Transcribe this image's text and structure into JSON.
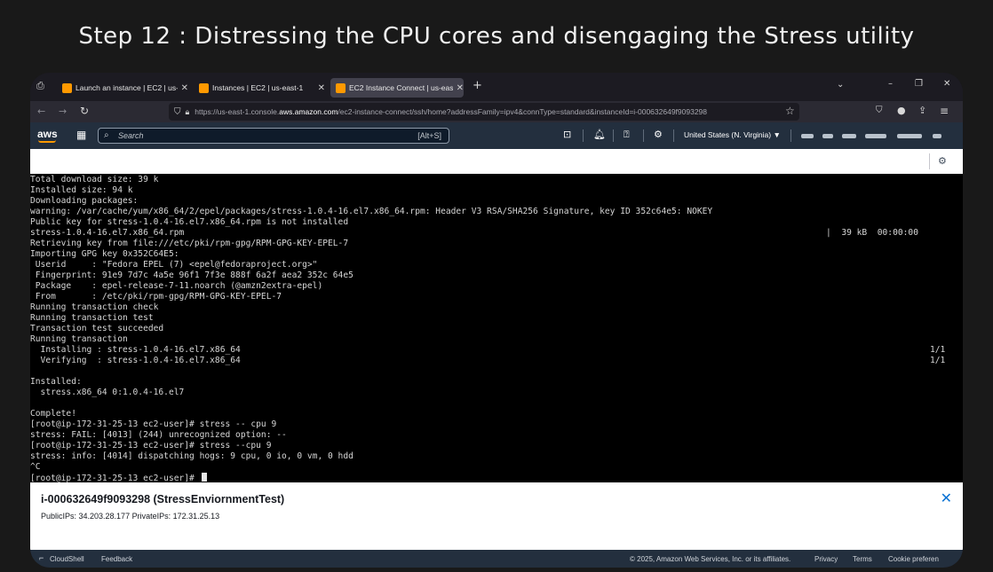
{
  "heading": "Step 12 : Distressing the CPU cores and disengaging the Stress utility",
  "browser": {
    "tabs": [
      {
        "label": "Launch an instance | EC2 | us-east-1",
        "active": false
      },
      {
        "label": "Instances | EC2 | us-east-1",
        "active": false
      },
      {
        "label": "EC2 Instance Connect | us-east-1",
        "active": true
      }
    ],
    "url_prefix": "https://us-east-1.console.",
    "url_host": "aws.amazon.com",
    "url_path": "/ec2-instance-connect/ssh/home?addressFamily=ipv4&connType=standard&instanceId=i-000632649f9093298"
  },
  "aws_header": {
    "logo": "aws",
    "search_placeholder": "Search",
    "search_shortcut": "[Alt+S]",
    "region": "United States (N. Virginia) ▼"
  },
  "terminal": {
    "lines": [
      "Total download size: 39 k",
      "Installed size: 94 k",
      "Downloading packages:",
      "warning: /var/cache/yum/x86_64/2/epel/packages/stress-1.0.4-16.el7.x86_64.rpm: Header V3 RSA/SHA256 Signature, key ID 352c64e5: NOKEY",
      "Public key for stress-1.0.4-16.el7.x86_64.rpm is not installed",
      "stress-1.0.4-16.el7.x86_64.rpm",
      "Retrieving key from file:///etc/pki/rpm-gpg/RPM-GPG-KEY-EPEL-7",
      "Importing GPG key 0x352C64E5:",
      " Userid     : \"Fedora EPEL (7) <epel@fedoraproject.org>\"",
      " Fingerprint: 91e9 7d7c 4a5e 96f1 7f3e 888f 6a2f aea2 352c 64e5",
      " Package    : epel-release-7-11.noarch (@amzn2extra-epel)",
      " From       : /etc/pki/rpm-gpg/RPM-GPG-KEY-EPEL-7",
      "Running transaction check",
      "Running transaction test",
      "Transaction test succeeded",
      "Running transaction",
      "  Installing : stress-1.0.4-16.el7.x86_64",
      "  Verifying  : stress-1.0.4-16.el7.x86_64",
      "",
      "Installed:",
      "  stress.x86_64 0:1.0.4-16.el7",
      "",
      "Complete!",
      "[root@ip-172-31-25-13 ec2-user]# stress -- cpu 9",
      "stress: FAIL: [4013] (244) unrecognized option: --",
      "[root@ip-172-31-25-13 ec2-user]# stress --cpu 9",
      "stress: info: [4014] dispatching hogs: 9 cpu, 0 io, 0 vm, 0 hdd",
      "^C",
      "[root@ip-172-31-25-13 ec2-user]# "
    ],
    "download_stat": "|  39 kB  00:00:00",
    "progress_1": "1/1",
    "progress_2": "1/1"
  },
  "instance": {
    "title": "i-000632649f9093298 (StressEnviornmentTest)",
    "ips": "PublicIPs: 34.203.28.177   PrivateIPs: 172.31.25.13"
  },
  "footer": {
    "cloudshell": "CloudShell",
    "feedback": "Feedback",
    "copyright": "© 2025, Amazon Web Services, Inc. or its affiliates.",
    "privacy": "Privacy",
    "terms": "Terms",
    "cookie": "Cookie preferen"
  }
}
